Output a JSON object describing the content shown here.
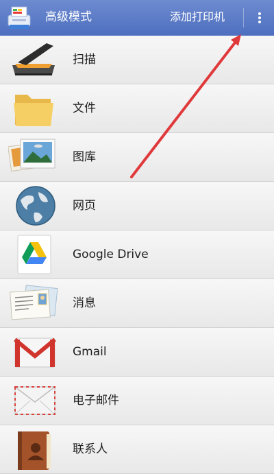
{
  "appbar": {
    "title": "高级模式",
    "action_label": "添加打印机",
    "logo_icon": "printer-icon",
    "overflow_icon": "more-vert-icon",
    "color": "#5a7ac6"
  },
  "items": [
    {
      "label": "扫描",
      "icon": "scanner-icon"
    },
    {
      "label": "文件",
      "icon": "folder-icon"
    },
    {
      "label": "图库",
      "icon": "photos-icon"
    },
    {
      "label": "网页",
      "icon": "globe-icon"
    },
    {
      "label": "Google Drive",
      "icon": "google-drive-icon"
    },
    {
      "label": "消息",
      "icon": "postcard-icon"
    },
    {
      "label": "Gmail",
      "icon": "gmail-icon"
    },
    {
      "label": "电子邮件",
      "icon": "envelope-icon"
    },
    {
      "label": "联系人",
      "icon": "contacts-book-icon"
    }
  ],
  "annotation": {
    "type": "arrow",
    "color": "#e0393b",
    "points_to": "overflow-menu-button"
  }
}
